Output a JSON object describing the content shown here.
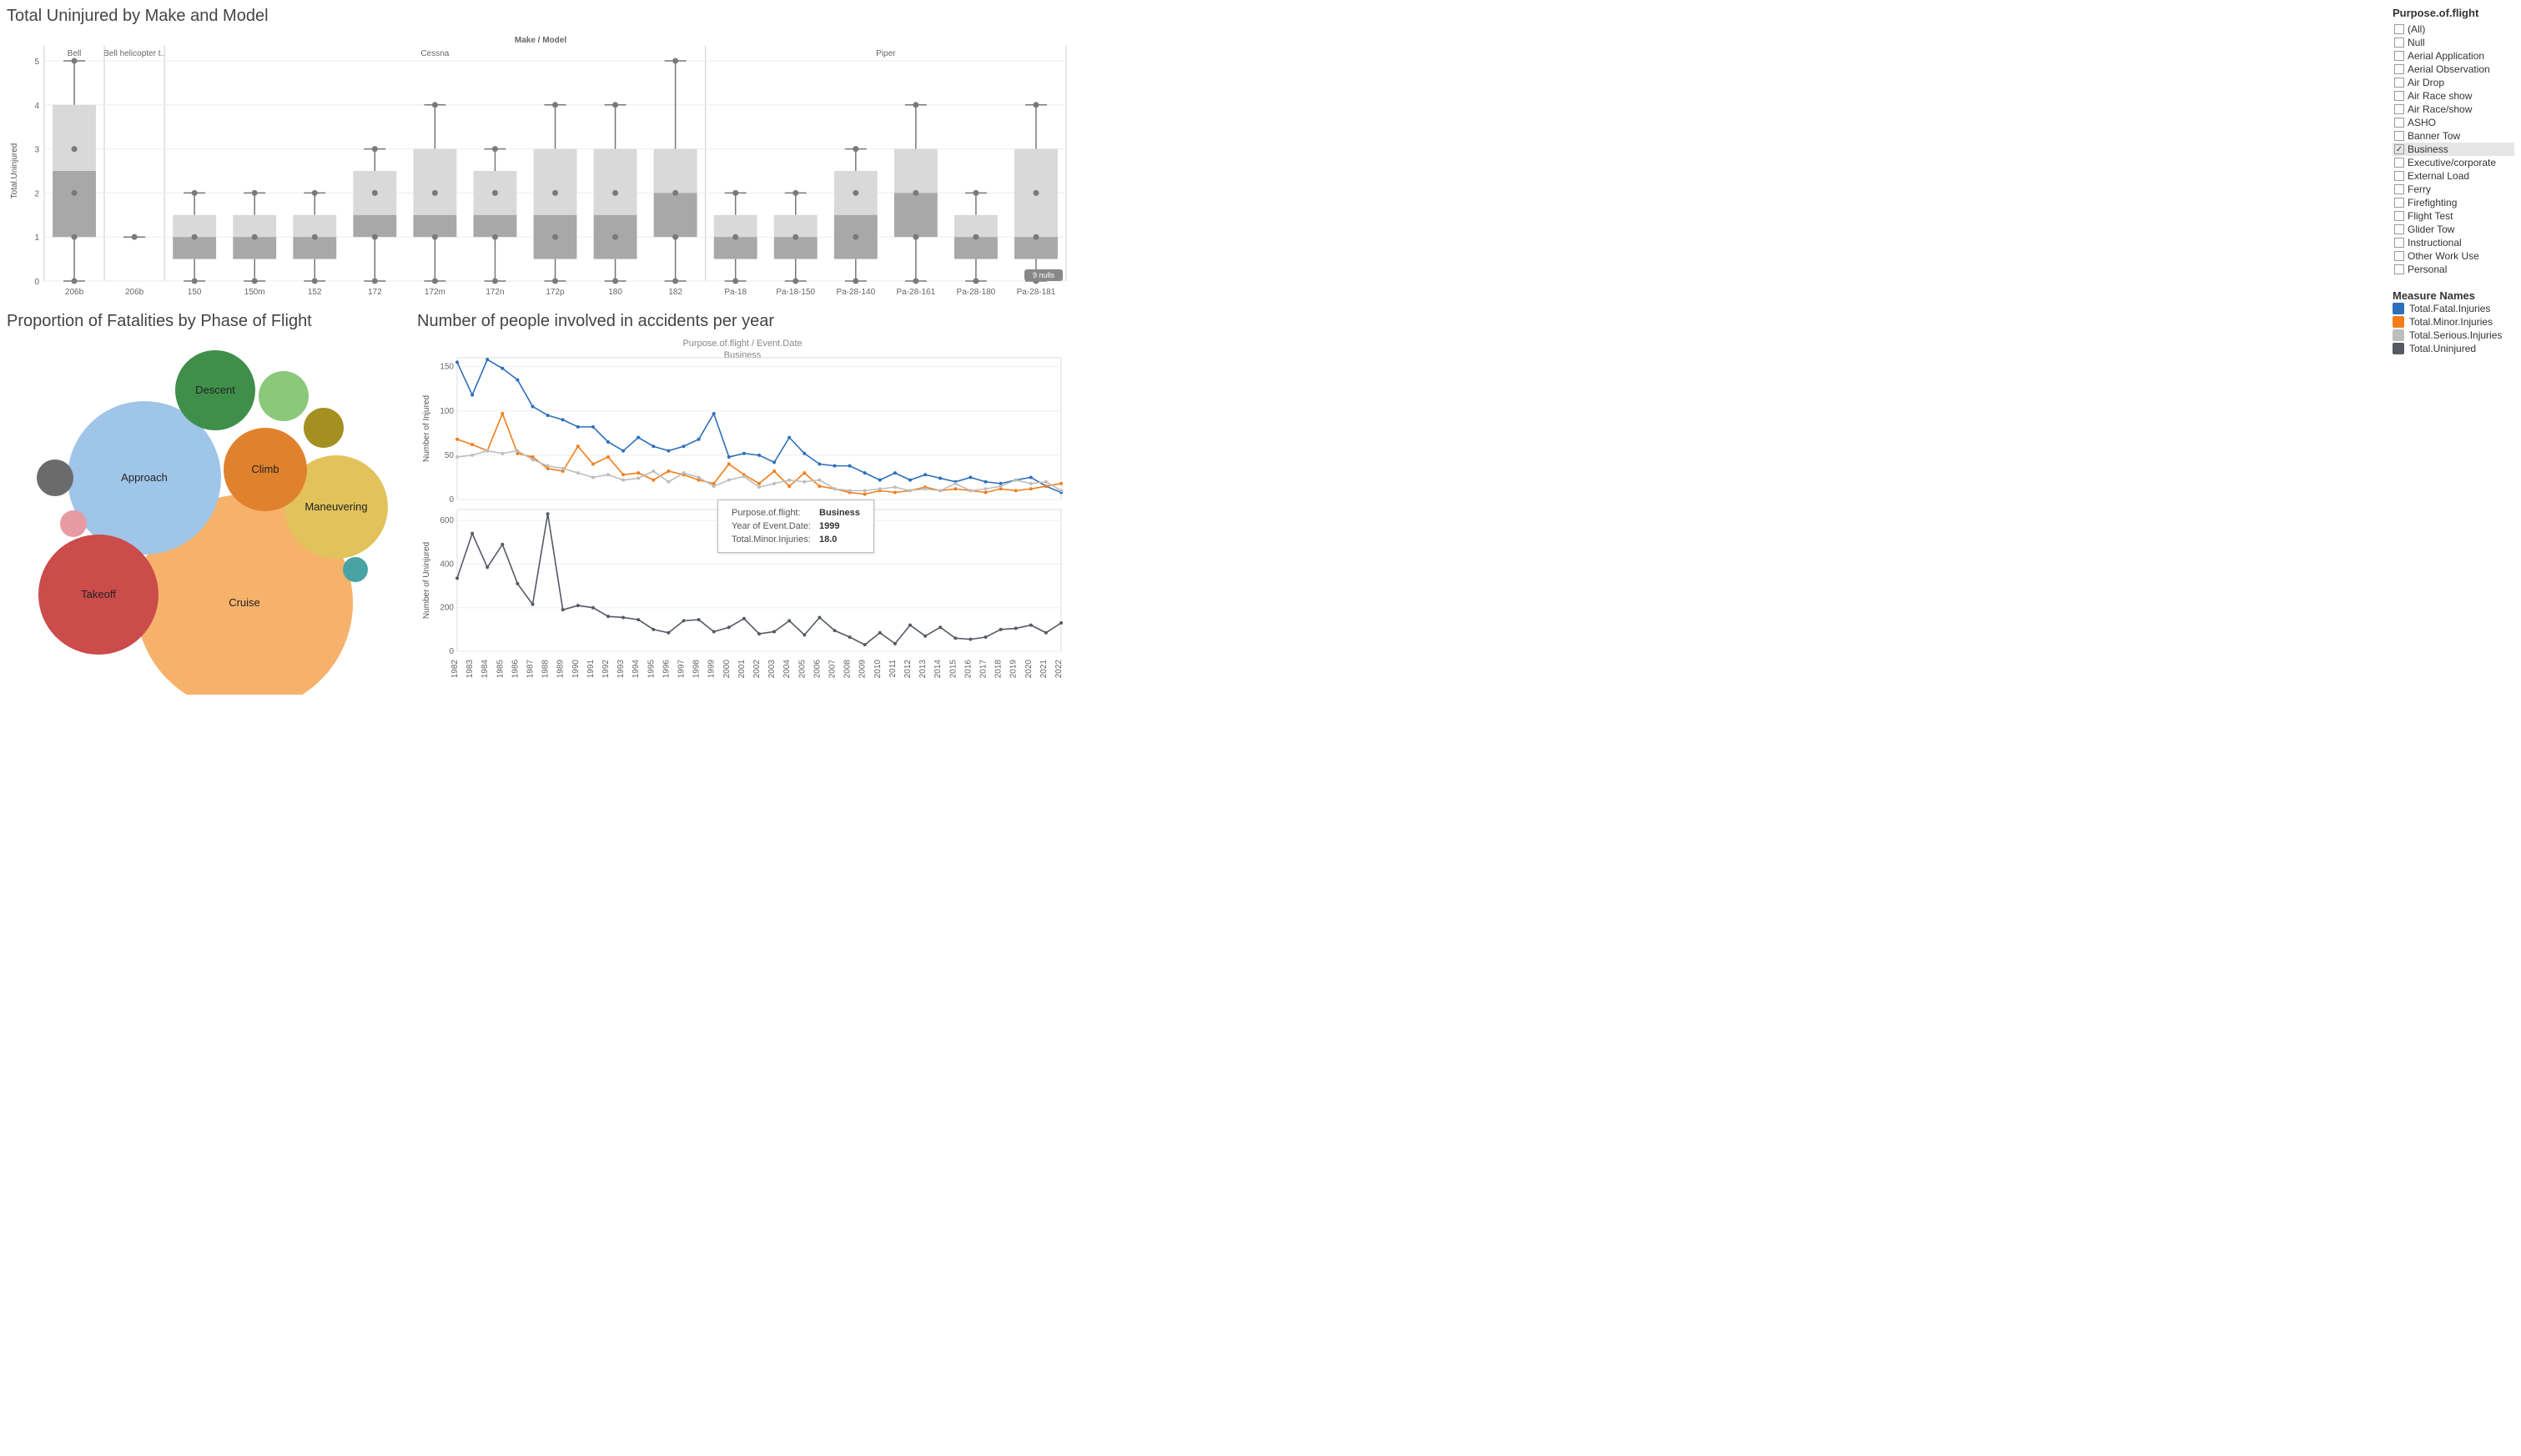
{
  "boxplot": {
    "title": "Total Uninjured by Make and Model",
    "axis_title": "Make / Model",
    "y_label": "Total.Uninjured",
    "nulls_badge": "9 nulls",
    "groups": [
      {
        "make": "Bell",
        "models": [
          "206b"
        ]
      },
      {
        "make": "Bell helicopter t..",
        "models": [
          "206b"
        ]
      },
      {
        "make": "Cessna",
        "models": [
          "150",
          "150m",
          "152",
          "172",
          "172m",
          "172n",
          "172p",
          "180",
          "182"
        ]
      },
      {
        "make": "Piper",
        "models": [
          "Pa-18",
          "Pa-18-150",
          "Pa-28-140",
          "Pa-28-161",
          "Pa-28-180",
          "Pa-28-181"
        ]
      }
    ]
  },
  "chart_data": [
    {
      "type": "box",
      "title": "Total Uninjured by Make and Model",
      "ylabel": "Total.Uninjured",
      "ylim": [
        0,
        5
      ],
      "categories_hier": [
        [
          "Bell",
          "206b"
        ],
        [
          "Bell helicopter t..",
          "206b"
        ],
        [
          "Cessna",
          "150"
        ],
        [
          "Cessna",
          "150m"
        ],
        [
          "Cessna",
          "152"
        ],
        [
          "Cessna",
          "172"
        ],
        [
          "Cessna",
          "172m"
        ],
        [
          "Cessna",
          "172n"
        ],
        [
          "Cessna",
          "172p"
        ],
        [
          "Cessna",
          "180"
        ],
        [
          "Cessna",
          "182"
        ],
        [
          "Piper",
          "Pa-18"
        ],
        [
          "Piper",
          "Pa-18-150"
        ],
        [
          "Piper",
          "Pa-28-140"
        ],
        [
          "Piper",
          "Pa-28-161"
        ],
        [
          "Piper",
          "Pa-28-180"
        ],
        [
          "Piper",
          "Pa-28-181"
        ]
      ],
      "boxes": [
        {
          "min": 0,
          "q1": 1,
          "median": 2.5,
          "q3": 4,
          "max": 5,
          "points": [
            0,
            1,
            2,
            3,
            5
          ]
        },
        {
          "min": 1,
          "q1": 1,
          "median": 1,
          "q3": 1,
          "max": 1,
          "points": [
            1
          ]
        },
        {
          "min": 0,
          "q1": 0.5,
          "median": 1,
          "q3": 1.5,
          "max": 2,
          "points": [
            0,
            1,
            2
          ]
        },
        {
          "min": 0,
          "q1": 0.5,
          "median": 1,
          "q3": 1.5,
          "max": 2,
          "points": [
            0,
            1,
            2
          ]
        },
        {
          "min": 0,
          "q1": 0.5,
          "median": 1,
          "q3": 1.5,
          "max": 2,
          "points": [
            0,
            1,
            2
          ]
        },
        {
          "min": 0,
          "q1": 1,
          "median": 1.5,
          "q3": 2.5,
          "max": 3,
          "points": [
            0,
            1,
            2,
            3
          ]
        },
        {
          "min": 0,
          "q1": 1,
          "median": 1.5,
          "q3": 3,
          "max": 4,
          "points": [
            0,
            1,
            2,
            4
          ]
        },
        {
          "min": 0,
          "q1": 1,
          "median": 1.5,
          "q3": 2.5,
          "max": 3,
          "points": [
            0,
            1,
            2,
            3
          ]
        },
        {
          "min": 0,
          "q1": 0.5,
          "median": 1.5,
          "q3": 3,
          "max": 4,
          "points": [
            0,
            1,
            2,
            4
          ]
        },
        {
          "min": 0,
          "q1": 0.5,
          "median": 1.5,
          "q3": 3,
          "max": 4,
          "points": [
            0,
            1,
            2,
            4
          ]
        },
        {
          "min": 0,
          "q1": 1,
          "median": 2,
          "q3": 3,
          "max": 5,
          "points": [
            0,
            1,
            2,
            5
          ]
        },
        {
          "min": 0,
          "q1": 0.5,
          "median": 1,
          "q3": 1.5,
          "max": 2,
          "points": [
            0,
            1,
            2
          ]
        },
        {
          "min": 0,
          "q1": 0.5,
          "median": 1,
          "q3": 1.5,
          "max": 2,
          "points": [
            0,
            1,
            2
          ]
        },
        {
          "min": 0,
          "q1": 0.5,
          "median": 1.5,
          "q3": 2.5,
          "max": 3,
          "points": [
            0,
            1,
            2,
            3
          ]
        },
        {
          "min": 0,
          "q1": 1,
          "median": 2,
          "q3": 3,
          "max": 4,
          "points": [
            0,
            1,
            2,
            4
          ]
        },
        {
          "min": 0,
          "q1": 0.5,
          "median": 1,
          "q3": 1.5,
          "max": 2,
          "points": [
            0,
            1,
            2
          ]
        },
        {
          "min": 0,
          "q1": 0.5,
          "median": 1,
          "q3": 3,
          "max": 4,
          "points": [
            0,
            1,
            2,
            4
          ]
        }
      ]
    },
    {
      "type": "bubble",
      "title": "Proportion of Fatalities by Phase of Flight",
      "items": [
        {
          "label": "Cruise",
          "value": 180,
          "color": "#f6b26b"
        },
        {
          "label": "Approach",
          "value": 110,
          "color": "#9fc5e8"
        },
        {
          "label": "Takeoff",
          "value": 85,
          "color": "#cc4b4b"
        },
        {
          "label": "Maneuvering",
          "value": 70,
          "color": "#e2c35b"
        },
        {
          "label": "Climb",
          "value": 55,
          "color": "#e0812d"
        },
        {
          "label": "Descent",
          "value": 50,
          "color": "#3f8f4a"
        },
        {
          "label": "",
          "value": 28,
          "color": "#8bc97a"
        },
        {
          "label": "",
          "value": 22,
          "color": "#a39021"
        },
        {
          "label": "",
          "value": 14,
          "color": "#6b6b6b"
        },
        {
          "label": "",
          "value": 10,
          "color": "#e89aa3"
        },
        {
          "label": "",
          "value": 10,
          "color": "#4aa3a3"
        }
      ]
    },
    {
      "type": "line",
      "title": "Number of people involved in accidents per year",
      "subtitle_top": "Purpose.of.flight / Event.Date",
      "subtitle_mid": "Business",
      "panels": [
        {
          "ylabel": "Number of Injured",
          "ylim": [
            0,
            160
          ],
          "x": [
            1982,
            1983,
            1984,
            1985,
            1986,
            1987,
            1988,
            1989,
            1990,
            1991,
            1992,
            1993,
            1994,
            1995,
            1996,
            1997,
            1998,
            1999,
            2000,
            2001,
            2002,
            2003,
            2004,
            2005,
            2006,
            2007,
            2008,
            2009,
            2010,
            2011,
            2012,
            2013,
            2014,
            2015,
            2016,
            2017,
            2018,
            2019,
            2020,
            2021,
            2022
          ],
          "series": [
            {
              "name": "Total.Fatal.Injuries",
              "color": "#2e6fbb",
              "values": [
                155,
                118,
                158,
                148,
                135,
                105,
                95,
                90,
                82,
                82,
                65,
                55,
                70,
                60,
                55,
                60,
                68,
                97,
                48,
                52,
                50,
                42,
                70,
                52,
                40,
                38,
                38,
                30,
                22,
                30,
                22,
                28,
                24,
                20,
                25,
                20,
                18,
                22,
                25,
                15,
                8
              ]
            },
            {
              "name": "Total.Minor.Injuries",
              "color": "#f27d1a",
              "values": [
                68,
                62,
                55,
                97,
                52,
                48,
                35,
                32,
                60,
                40,
                48,
                28,
                30,
                22,
                32,
                28,
                22,
                18,
                40,
                28,
                18,
                32,
                15,
                30,
                15,
                12,
                8,
                6,
                10,
                8,
                10,
                14,
                10,
                12,
                10,
                8,
                12,
                10,
                12,
                15,
                18
              ]
            },
            {
              "name": "Total.Serious.Injuries",
              "color": "#bdbdbd",
              "values": [
                48,
                50,
                55,
                52,
                55,
                45,
                38,
                35,
                30,
                25,
                28,
                22,
                24,
                32,
                20,
                30,
                25,
                15,
                22,
                26,
                14,
                18,
                22,
                20,
                22,
                12,
                10,
                10,
                12,
                14,
                10,
                12,
                10,
                18,
                10,
                12,
                15,
                22,
                18,
                20,
                10
              ]
            }
          ]
        },
        {
          "ylabel": "Number of Uninjured",
          "ylim": [
            0,
            650
          ],
          "x": [
            1982,
            1983,
            1984,
            1985,
            1986,
            1987,
            1988,
            1989,
            1990,
            1991,
            1992,
            1993,
            1994,
            1995,
            1996,
            1997,
            1998,
            1999,
            2000,
            2001,
            2002,
            2003,
            2004,
            2005,
            2006,
            2007,
            2008,
            2009,
            2010,
            2011,
            2012,
            2013,
            2014,
            2015,
            2016,
            2017,
            2018,
            2019,
            2020,
            2021,
            2022
          ],
          "series": [
            {
              "name": "Total.Uninjured",
              "color": "#555a63",
              "values": [
                335,
                540,
                385,
                490,
                310,
                215,
                630,
                190,
                210,
                200,
                160,
                155,
                145,
                100,
                85,
                140,
                145,
                90,
                110,
                150,
                80,
                90,
                140,
                75,
                155,
                95,
                65,
                30,
                85,
                35,
                120,
                70,
                110,
                60,
                55,
                65,
                100,
                105,
                120,
                85,
                130
              ]
            }
          ]
        }
      ],
      "tooltip": {
        "rows": [
          [
            "Purpose.of.flight:",
            "Business"
          ],
          [
            "Year of Event.Date:",
            "1999"
          ],
          [
            "Total.Minor.Injuries:",
            "18.0"
          ]
        ]
      }
    }
  ],
  "bubble_title": "Proportion of Fatalities by Phase of Flight",
  "lines_title": "Number of people involved in accidents per year",
  "filter": {
    "title": "Purpose.of.flight",
    "options": [
      {
        "label": "(All)",
        "checked": false
      },
      {
        "label": "Null",
        "checked": false
      },
      {
        "label": "Aerial Application",
        "checked": false
      },
      {
        "label": "Aerial Observation",
        "checked": false
      },
      {
        "label": "Air Drop",
        "checked": false
      },
      {
        "label": "Air Race show",
        "checked": false
      },
      {
        "label": "Air Race/show",
        "checked": false
      },
      {
        "label": "ASHO",
        "checked": false
      },
      {
        "label": "Banner Tow",
        "checked": false
      },
      {
        "label": "Business",
        "checked": true
      },
      {
        "label": "Executive/corporate",
        "checked": false
      },
      {
        "label": "External Load",
        "checked": false
      },
      {
        "label": "Ferry",
        "checked": false
      },
      {
        "label": "Firefighting",
        "checked": false
      },
      {
        "label": "Flight Test",
        "checked": false
      },
      {
        "label": "Glider Tow",
        "checked": false
      },
      {
        "label": "Instructional",
        "checked": false
      },
      {
        "label": "Other Work Use",
        "checked": false
      },
      {
        "label": "Personal",
        "checked": false
      }
    ]
  },
  "legend": {
    "title": "Measure Names",
    "items": [
      {
        "label": "Total.Fatal.Injuries",
        "color": "#2e6fbb"
      },
      {
        "label": "Total.Minor.Injuries",
        "color": "#f27d1a"
      },
      {
        "label": "Total.Serious.Injuries",
        "color": "#bdbdbd"
      },
      {
        "label": "Total.Uninjured",
        "color": "#555a63"
      }
    ]
  }
}
